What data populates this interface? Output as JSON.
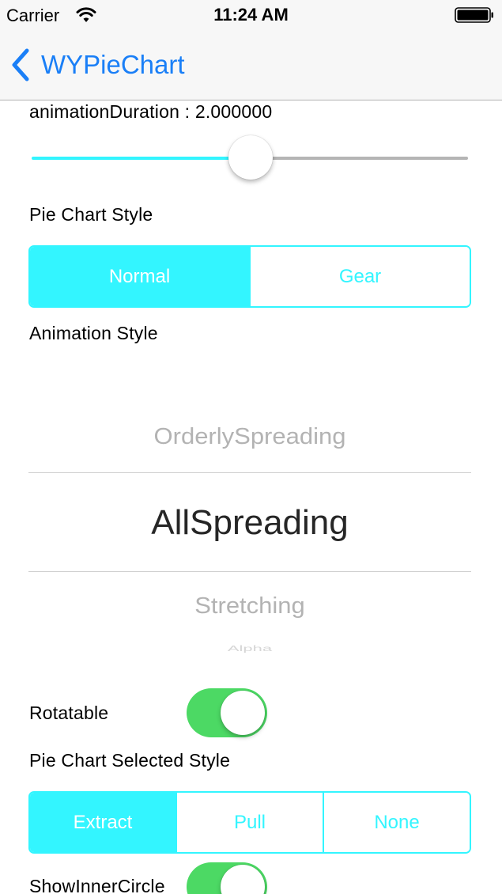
{
  "status_bar": {
    "carrier": "Carrier",
    "time": "11:24 AM",
    "wifi_icon": "wifi-icon",
    "battery_icon": "battery-icon"
  },
  "nav": {
    "back_icon": "chevron-left-icon",
    "title": "WYPieChart"
  },
  "animation_duration": {
    "label": "animationDuration : 2.000000",
    "slider_fraction": 0.5
  },
  "pie_chart_style": {
    "label": "Pie Chart Style",
    "segments": [
      "Normal",
      "Gear"
    ],
    "selected_index": 0
  },
  "animation_style": {
    "label": "Animation Style",
    "picker_items": [
      "OrderlySpreading",
      "AllSpreading",
      "Stretching",
      "Alpha"
    ],
    "selected": "AllSpreading"
  },
  "rotatable": {
    "label": "Rotatable",
    "on": true
  },
  "selected_style": {
    "label": "Pie Chart Selected Style",
    "segments": [
      "Extract",
      "Pull",
      "None"
    ],
    "selected_index": 0
  },
  "show_inner_circle": {
    "label": "ShowInnerCircle",
    "on": true
  },
  "colors": {
    "tint": "#33f5ff",
    "nav_tint": "#1a7ff7",
    "switch_on": "#4cd964",
    "bar_background": "#f7f7f7"
  }
}
